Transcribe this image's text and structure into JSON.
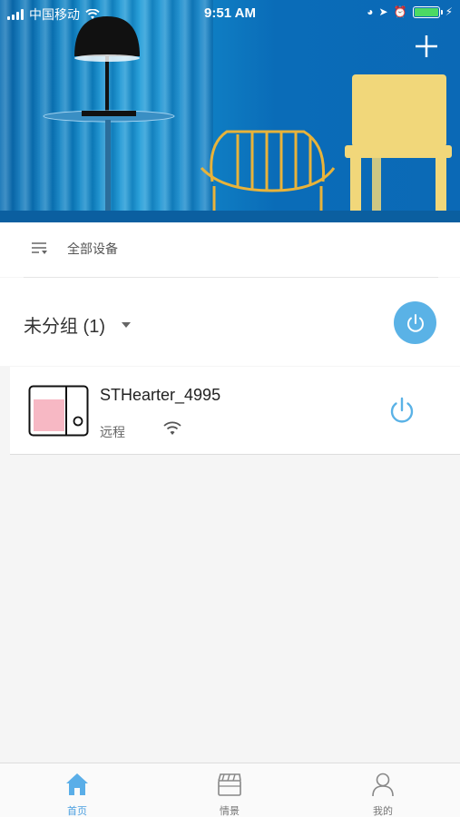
{
  "status_bar": {
    "carrier": "中国移动",
    "time": "9:51 AM",
    "battery_color": "#4cd964"
  },
  "header": {
    "add_icon": "plus-icon"
  },
  "filter": {
    "label": "全部设备",
    "icon": "filter-list-icon"
  },
  "group": {
    "title": "未分组 (1)",
    "power_color": "#5ab2e6"
  },
  "devices": [
    {
      "name": "STHearter_4995",
      "mode": "远程",
      "connection_icon": "wifi-icon"
    }
  ],
  "tabbar": {
    "tabs": [
      {
        "label": "首页",
        "icon": "home-icon",
        "active": true
      },
      {
        "label": "情景",
        "icon": "scene-clapper-icon",
        "active": false
      },
      {
        "label": "我的",
        "icon": "user-icon",
        "active": false
      }
    ],
    "active_color": "#4a9fe0"
  }
}
